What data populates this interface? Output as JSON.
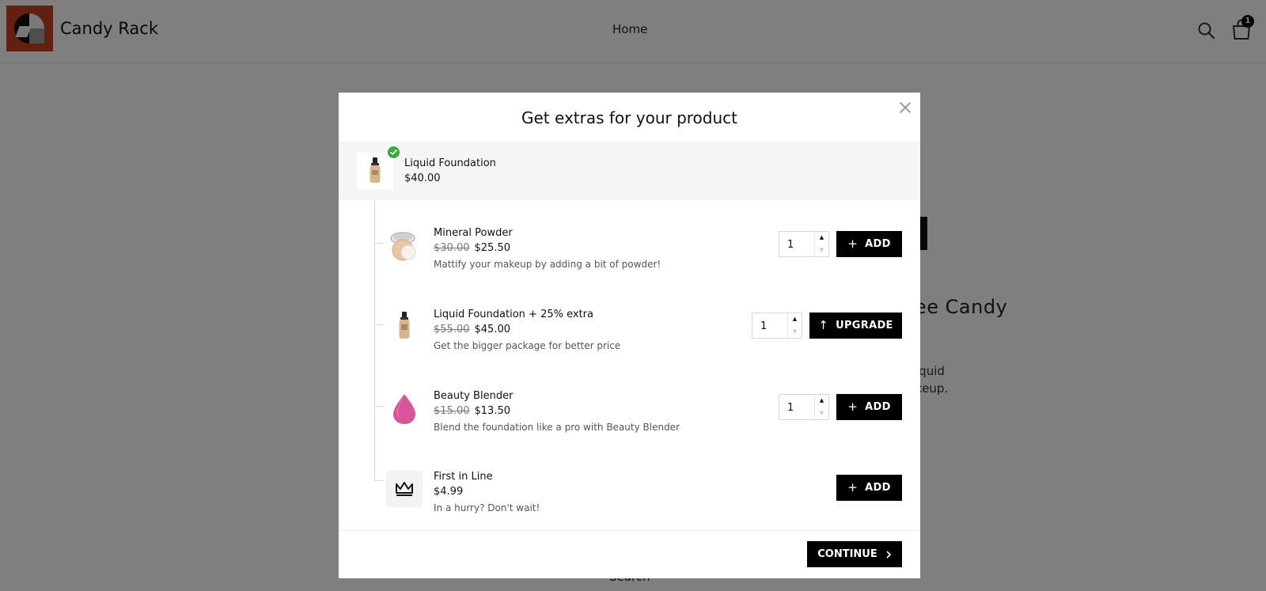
{
  "header": {
    "brand": "Candy Rack",
    "nav_home": "Home",
    "cart_count": "1"
  },
  "background": {
    "heading": "ee Candy",
    "line1": "iquid",
    "line2": "keup.",
    "search_link": "Search"
  },
  "modal": {
    "title": "Get extras for your product",
    "main_product": {
      "name": "Liquid Foundation",
      "price": "$40.00"
    },
    "offers": [
      {
        "name": "Mineral Powder",
        "old_price": "$30.00",
        "price": "$25.50",
        "description": "Mattify your makeup by adding a bit of powder!",
        "quantity": "1",
        "button_label": "ADD",
        "button_icon": "plus-icon"
      },
      {
        "name": "Liquid Foundation + 25% extra",
        "old_price": "$55.00",
        "price": "$45.00",
        "description": "Get the bigger package for better price",
        "quantity": "1",
        "button_label": "UPGRADE",
        "button_icon": "arrow-up-icon"
      },
      {
        "name": "Beauty Blender",
        "old_price": "$15.00",
        "price": "$13.50",
        "description": "Blend the foundation like a pro with Beauty Blender",
        "quantity": "1",
        "button_label": "ADD",
        "button_icon": "plus-icon"
      },
      {
        "name": "First in Line",
        "price": "$4.99",
        "description": "In a hurry? Don't wait!",
        "button_label": "ADD",
        "button_icon": "plus-icon"
      }
    ],
    "continue_label": "CONTINUE"
  },
  "colors": {
    "overlay": "#000000",
    "button": "#000000",
    "check_badge": "#3aab3a",
    "logo": "#c8401f"
  }
}
